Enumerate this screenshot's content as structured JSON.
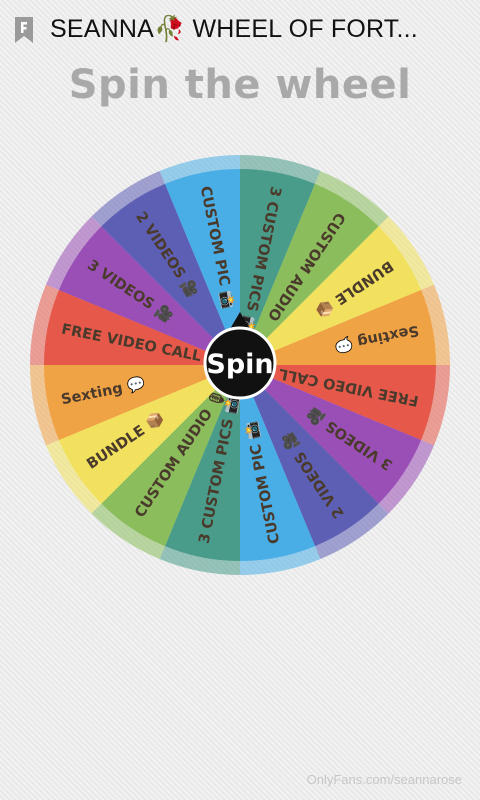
{
  "header": {
    "title": "SEANNA🥀 WHEEL OF FORT...",
    "bookmark_icon": "bookmark-f-icon"
  },
  "page": {
    "title": "Spin the wheel"
  },
  "wheel": {
    "spin_label": "Spin",
    "segments": [
      {
        "label": "3 CUSTOM PICS 📸",
        "color": "#4a9c8a"
      },
      {
        "label": "CUSTOM AUDIO",
        "color": "#8bbd5c"
      },
      {
        "label": "BUNDLE 📦",
        "color": "#f2e15e"
      },
      {
        "label": "Sexting 💬",
        "color": "#f0a344"
      },
      {
        "label": "FREE VIDEO CALL",
        "color": "#e6594a"
      },
      {
        "label": "3 VIDEOS 🎥",
        "color": "#9a4fb6"
      },
      {
        "label": "2 VIDEOS 🎥",
        "color": "#5d5fb5"
      },
      {
        "label": "CUSTOM PIC 📸",
        "color": "#49aee6"
      },
      {
        "label": "3 CUSTOM PICS 📸",
        "color": "#4a9c8a"
      },
      {
        "label": "CUSTOM AUDIO 🎙",
        "color": "#8bbd5c"
      },
      {
        "label": "BUNDLE 📦",
        "color": "#f2e15e"
      },
      {
        "label": "Sexting 💬",
        "color": "#f0a344"
      },
      {
        "label": "FREE VIDEO CALL",
        "color": "#e6594a"
      },
      {
        "label": "3 VIDEOS 🎥",
        "color": "#9a4fb6"
      },
      {
        "label": "2 VIDEOS 🎥",
        "color": "#5d5fb5"
      },
      {
        "label": "CUSTOM PIC 📸",
        "color": "#49aee6"
      }
    ]
  },
  "watermark": "OnlyFans.com/seannarose"
}
